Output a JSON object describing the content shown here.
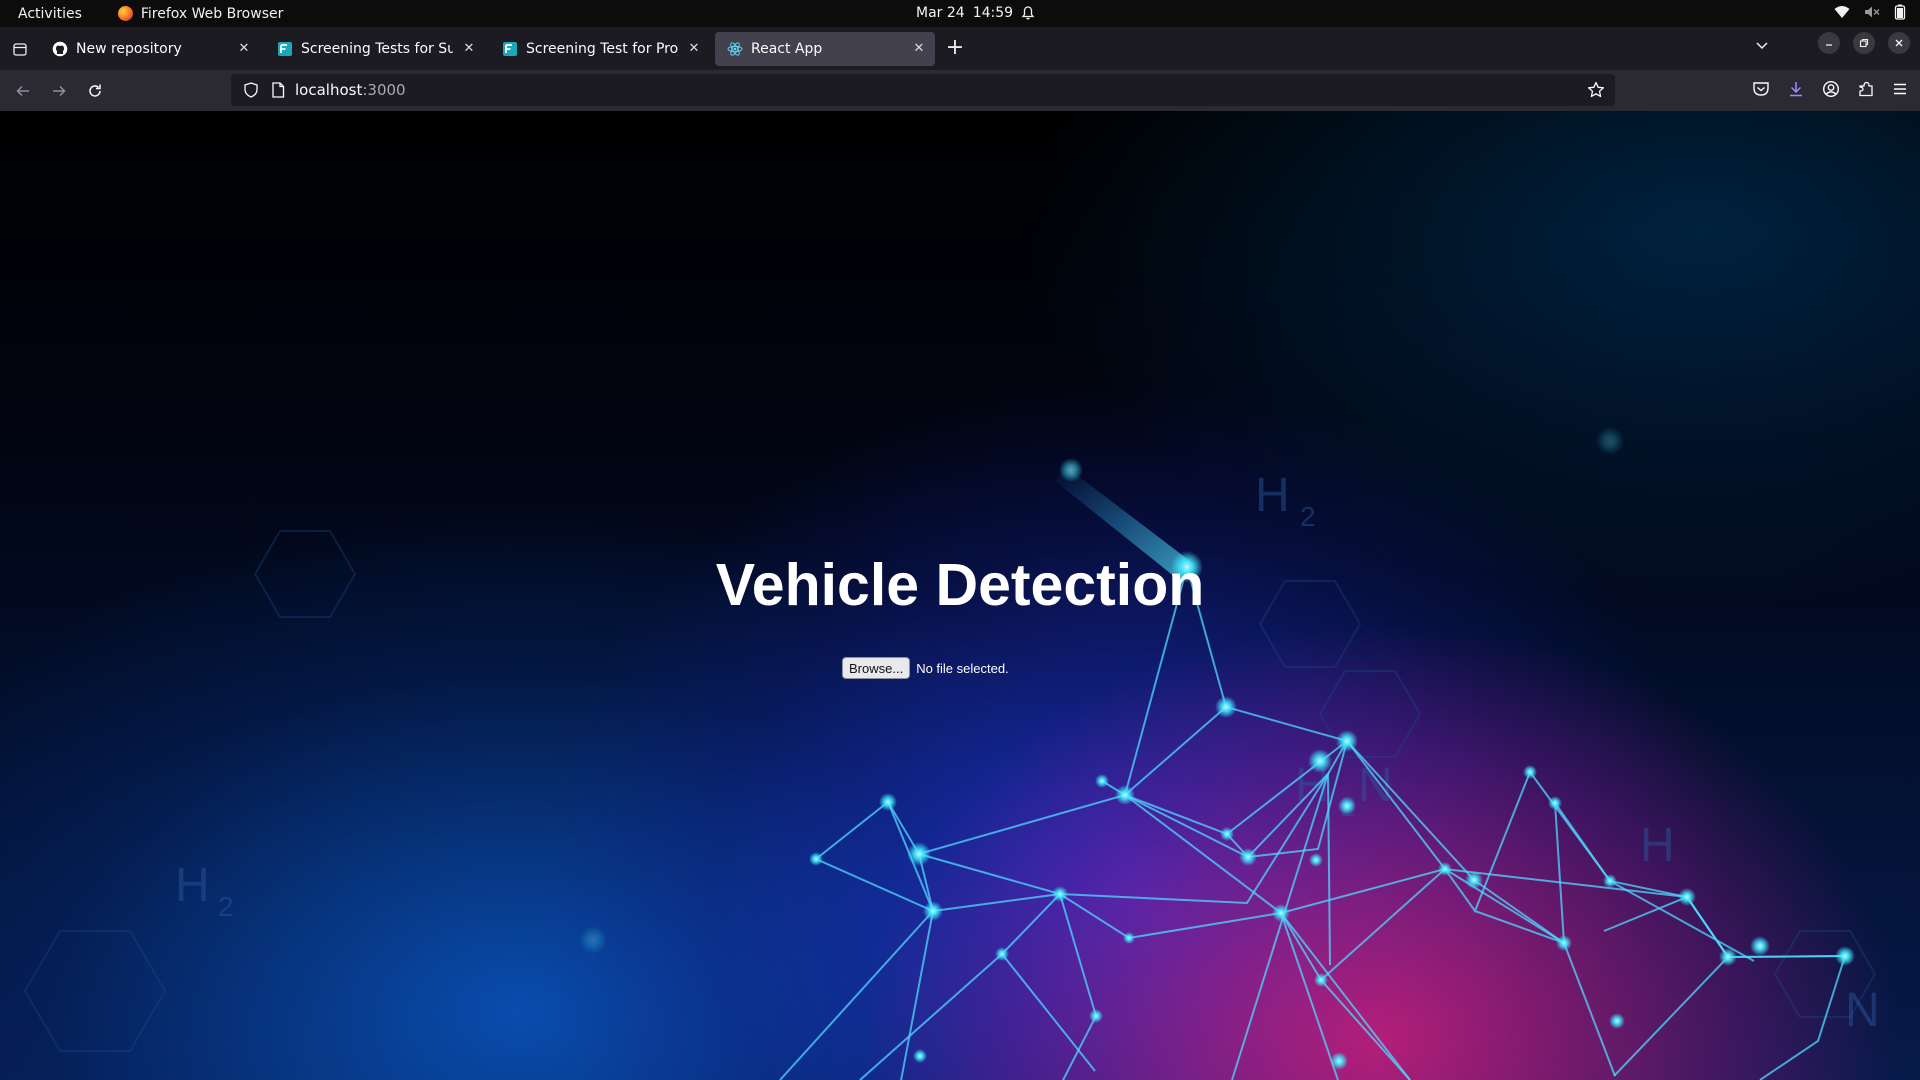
{
  "topbar": {
    "activities": "Activities",
    "app_name": "Firefox Web Browser",
    "date": "Mar 24",
    "time": "14:59"
  },
  "tabs": [
    {
      "label": "New repository",
      "icon": "github-icon",
      "active": false
    },
    {
      "label": "Screening Tests for Summ",
      "icon": "site-icon",
      "active": false
    },
    {
      "label": "Screening Test for Projec",
      "icon": "site-icon",
      "active": false
    },
    {
      "label": "React App",
      "icon": "react-icon",
      "active": true
    }
  ],
  "navbar": {
    "url_host": "localhost",
    "url_port": ":3000"
  },
  "page": {
    "title": "Vehicle Detection",
    "browse_label": "Browse...",
    "file_status": "No file selected."
  },
  "colors": {
    "accent_cyan": "#3fe8ff",
    "accent_pink": "#e81e78",
    "chrome_dark": "#1c1b22"
  }
}
